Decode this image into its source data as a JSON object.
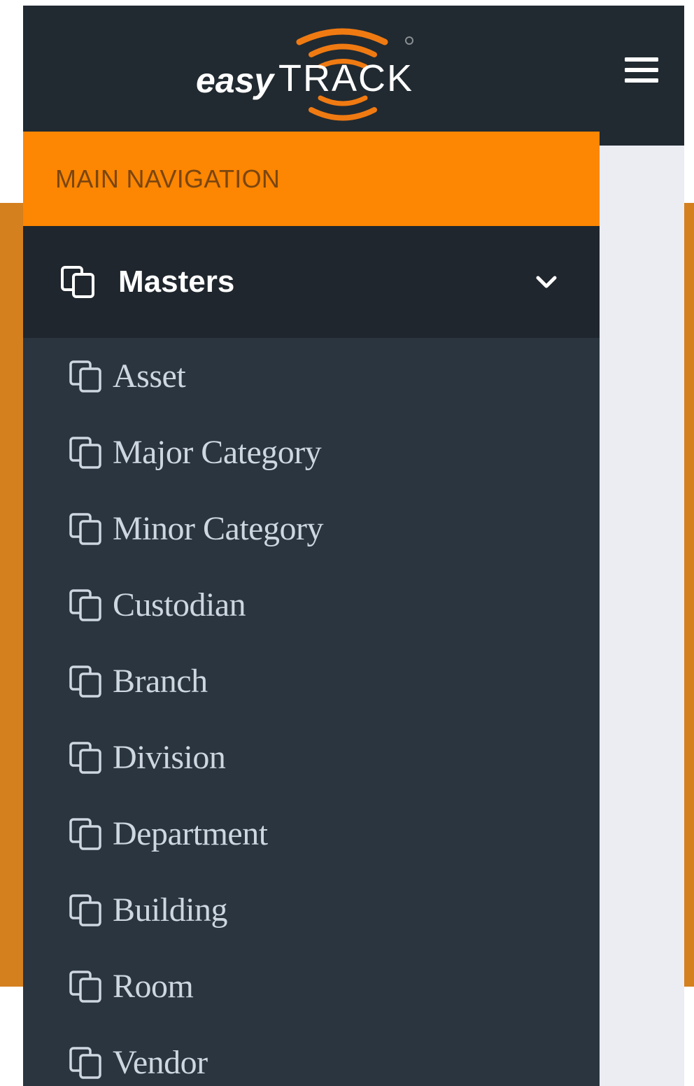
{
  "header": {
    "logo_text_primary": "easy",
    "logo_text_secondary": "TRACK",
    "menu_icon": "hamburger-menu-icon"
  },
  "sidebar": {
    "section_title": "MAIN NAVIGATION",
    "masters": {
      "label": "Masters",
      "icon": "copy-icon",
      "expanded": true,
      "chevron_icon": "chevron-down-icon"
    },
    "items": [
      {
        "label": "Asset"
      },
      {
        "label": "Major Category"
      },
      {
        "label": "Minor Category"
      },
      {
        "label": "Custodian"
      },
      {
        "label": "Branch"
      },
      {
        "label": "Division"
      },
      {
        "label": "Department"
      },
      {
        "label": "Building"
      },
      {
        "label": "Room"
      },
      {
        "label": "Vendor"
      }
    ]
  },
  "colors": {
    "accent": "#fd8602",
    "topbar": "#212a31",
    "sidebar": "#2a353f",
    "background": "#d5801f"
  }
}
